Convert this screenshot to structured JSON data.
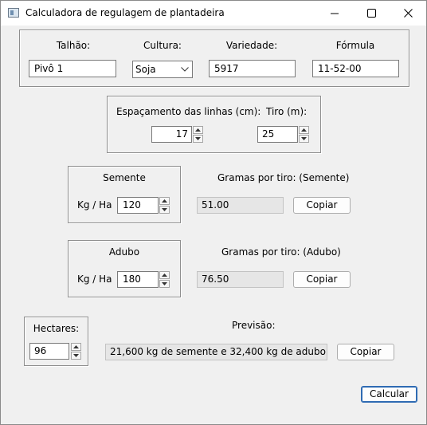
{
  "window": {
    "title": "Calculadora de regulagem de plantadeira",
    "controls": {
      "minimize": "minimize-icon",
      "maximize": "maximize-icon",
      "close": "close-icon"
    }
  },
  "field_info": {
    "talhao_label": "Talhão:",
    "talhao_value": "Pivô 1",
    "cultura_label": "Cultura:",
    "cultura_value": "Soja",
    "variedade_label": "Variedade:",
    "variedade_value": "5917",
    "formula_label": "Fórmula",
    "formula_value": "11-52-00"
  },
  "spacing": {
    "espacamento_label": "Espaçamento das linhas (cm):",
    "espacamento_value": "17",
    "tiro_label": "Tiro (m):",
    "tiro_value": "25"
  },
  "semente": {
    "group_label": "Semente",
    "unit_label": "Kg / Ha",
    "value": "120",
    "result_label": "Gramas por tiro: (Semente)",
    "result_value": "51.00",
    "copy_label": "Copiar"
  },
  "adubo": {
    "group_label": "Adubo",
    "unit_label": "Kg / Ha",
    "value": "180",
    "result_label": "Gramas por tiro: (Adubo)",
    "result_value": "76.50",
    "copy_label": "Copiar"
  },
  "hectares": {
    "label": "Hectares:",
    "value": "96"
  },
  "previsao": {
    "label": "Previsão:",
    "value": "21,600 kg de semente e 32,400 kg de adubo",
    "copy_label": "Copiar"
  },
  "calcular_label": "Calcular"
}
